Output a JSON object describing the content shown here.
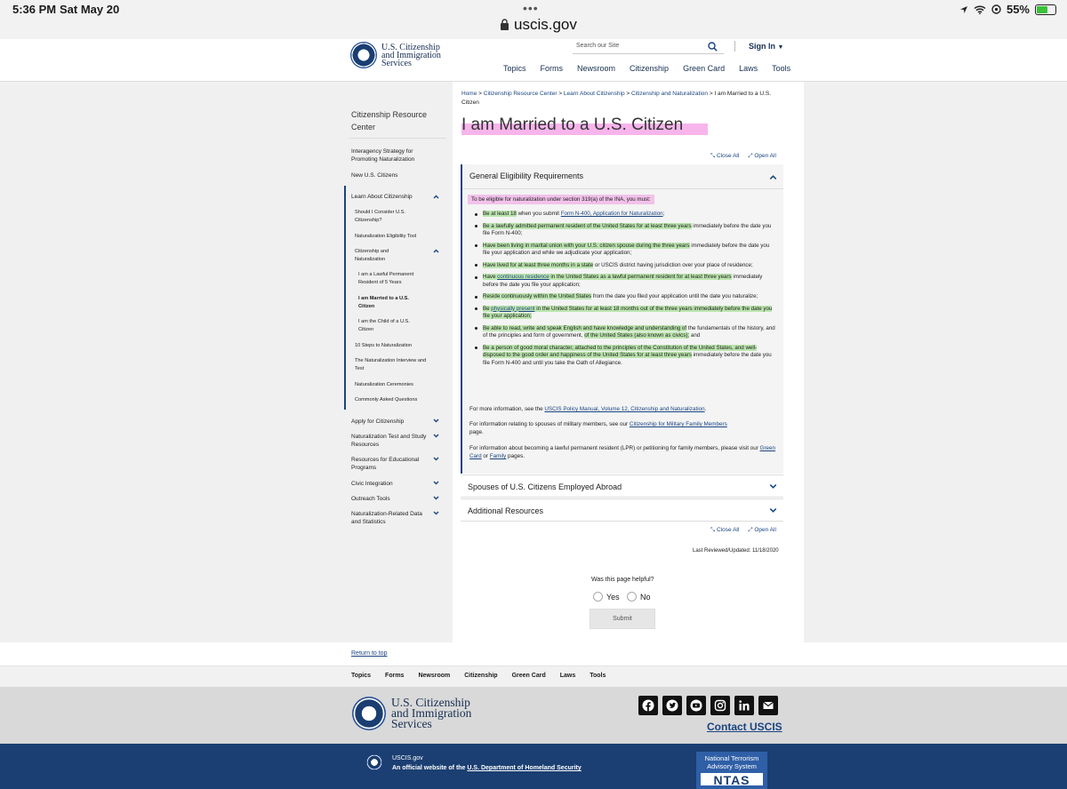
{
  "status_bar": {
    "time": "5:36 PM",
    "date": "Sat May 20",
    "url": "uscis.gov",
    "battery": "55%"
  },
  "header": {
    "agency_line1": "U.S. Citizenship",
    "agency_line2": "and Immigration",
    "agency_line3": "Services",
    "search_placeholder": "Search our Site",
    "sign_in": "Sign In",
    "nav": [
      "Topics",
      "Forms",
      "Newsroom",
      "Citizenship",
      "Green Card",
      "Laws",
      "Tools"
    ]
  },
  "sidebar": {
    "title": "Citizenship Resource Center",
    "items": [
      "Interagency Strategy for Promoting Naturalization",
      "New U.S. Citizens",
      "Learn About Citizenship",
      "Should I Consider U.S. Citizenship?",
      "Naturalization Eligibility Tool",
      "Citizenship and Naturalization",
      "I am a Lawful Permanent Resident of 5 Years",
      "I am Married to a U.S. Citizen",
      "I am the Child of a U.S. Citizen",
      "10 Steps to Naturalization",
      "The Naturalization Interview and Test",
      "Naturalization Ceremonies",
      "Commonly Asked Questions",
      "Apply for Citizenship",
      "Naturalization Test and Study Resources",
      "Resources for Educational Programs",
      "Civic Integration",
      "Outreach Tools",
      "Naturalization-Related Data and Statistics"
    ]
  },
  "breadcrumb": {
    "items": [
      "Home",
      "Citizenship Resource Center",
      "Learn About Citizenship",
      "Citizenship and Naturalization"
    ],
    "current": "I am Married to a U.S. Citizen",
    "sep": ">"
  },
  "page": {
    "title": "I am Married to a U.S. Citizen",
    "close_all": "Close All",
    "open_all": "Open All",
    "last_reviewed": "Last Reviewed/Updated:  11/18/2020"
  },
  "accordion": {
    "sections": [
      "General Eligibility Requirements",
      "Spouses of U.S. Citizens Employed Abroad",
      "Additional Resources"
    ],
    "intro": "To be eligible for naturalization under section 319(a) of the INA, you must:",
    "r1": {
      "a": "Be at least 18",
      "b": " when you submit ",
      "c": "Form N-400, Application for Naturalization",
      "d": ";"
    },
    "r2": {
      "a": "Be a lawfully admitted permanent resident of the United States for at least three years",
      "b": " immediately before the date you file Form N-400;"
    },
    "r3": {
      "a": "Have been living in marital union with your U.S. citizen spouse during the three years",
      "b": " immediately before the date you file your application and while we adjudicate your application;"
    },
    "r4": {
      "a": "Have lived for at least three months in a state",
      "b": " or USCIS district having jurisdiction over your place of residence;"
    },
    "r5": {
      "a": "Have ",
      "b": "continuous residence",
      "c": " in the United States as a lawful permanent resident for at least three years",
      "d": " immediately before the date you file your application;"
    },
    "r6": {
      "a": "Reside continuously within the United States",
      "b": " from the date you filed your application until the date you naturalize;"
    },
    "r7": {
      "a": "Be ",
      "b": "physically present",
      "c": " in the United States for at least 18 months out of the three years immediately before the date you file your application;",
      "d": ""
    },
    "r8": {
      "a": "Be able to read, write and speak English and have knowledge and understanding of",
      "b": " the fundamentals of the history, and of the principles and form of government, ",
      "c": "of the United States (also known as civics);",
      "d": " and"
    },
    "r9": {
      "a": "Be a person of good moral character, attached to the principles of the Constitution of the United States, and well-disposed to the good order and happiness of the United States for at least three years",
      "b": " immediately before the date you file Form N-400 and until you take the Oath of Allegiance."
    },
    "p1": {
      "a": "For more information, see the ",
      "b": "USCIS Policy Manual, Volume 12, Citizenship and Naturalization",
      "c": "."
    },
    "p2": {
      "a": "For information relating to spouses of military members, see our ",
      "b": "Citizenship for Military Family Members",
      "c": " page."
    },
    "p3": {
      "a": "For information about becoming a lawful permanent resident (LPR) or petitioning for family members, please visit our ",
      "b": "Green Card",
      "c": " or ",
      "d": "Family",
      "e": " pages."
    }
  },
  "feedback": {
    "question": "Was this page helpful?",
    "yes": "Yes",
    "no": "No",
    "submit": "Submit"
  },
  "footer": {
    "return_top": "Return to top",
    "nav": [
      "Topics",
      "Forms",
      "Newsroom",
      "Citizenship",
      "Green Card",
      "Laws",
      "Tools"
    ],
    "contact": "Contact USCIS",
    "site": "USCIS.gov",
    "official_a": "An official website of the ",
    "official_link": "U.S. Department of Homeland Security",
    "ntas_line1": "National Terrorism",
    "ntas_line2": "Advisory System",
    "ntas_logo": "NTAS"
  }
}
